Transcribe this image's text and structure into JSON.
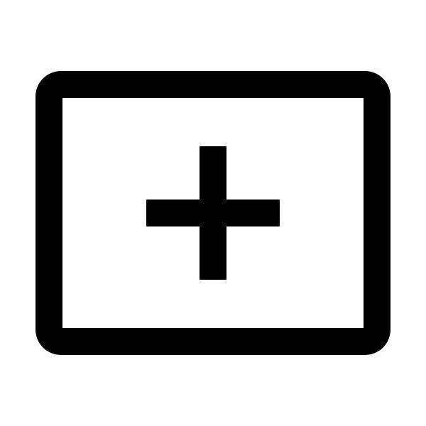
{
  "icon": {
    "name": "add-frame-icon",
    "glyph": "plus",
    "stroke_color": "#000000",
    "background_color": "#ffffff"
  }
}
